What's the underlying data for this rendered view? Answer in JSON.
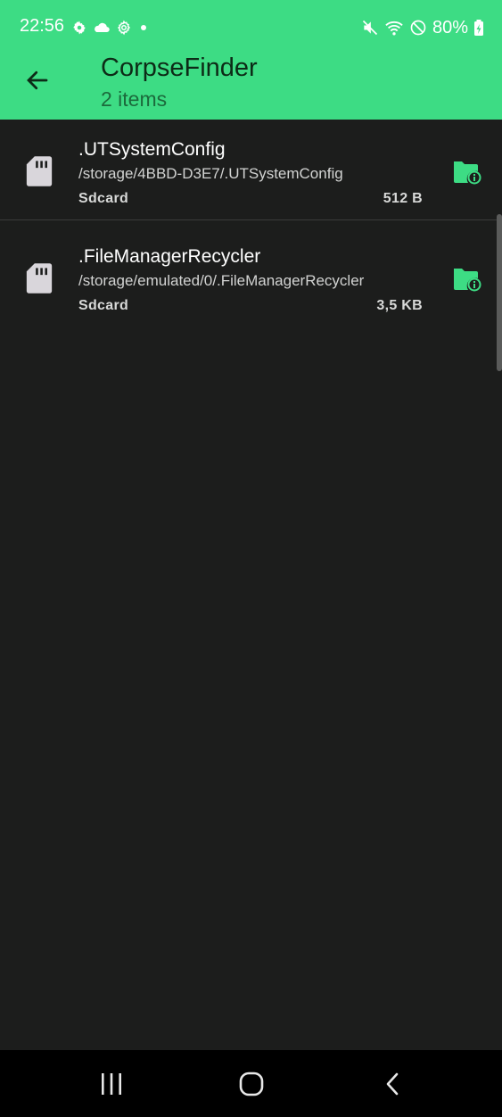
{
  "status_bar": {
    "time": "22:56",
    "battery": "80%",
    "icons_left": [
      "settings-icon",
      "cloud-icon",
      "gear-outline-icon",
      "dot-icon"
    ],
    "icons_right": [
      "mute-icon",
      "wifi-icon",
      "do-not-disturb-icon",
      "battery-charging-icon"
    ]
  },
  "app_bar": {
    "title": "CorpseFinder",
    "subtitle": "2 items",
    "background": "#3ddc84"
  },
  "items": [
    {
      "name": ".UTSystemConfig",
      "path": "/storage/4BBD-D3E7/.UTSystemConfig",
      "area": "Sdcard",
      "size": "512 B"
    },
    {
      "name": ".FileManagerRecycler",
      "path": "/storage/emulated/0/.FileManagerRecycler",
      "area": "Sdcard",
      "size": "3,5 KB"
    }
  ],
  "colors": {
    "accent": "#3ddc84",
    "background": "#1c1d1c",
    "nav_bar": "#000000"
  }
}
